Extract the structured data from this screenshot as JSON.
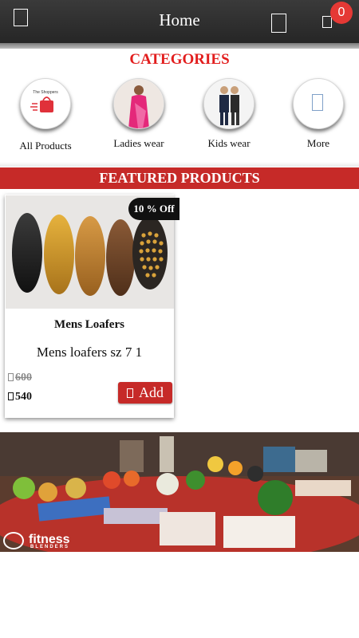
{
  "header": {
    "title": "Home",
    "cart_count": "0",
    "menu_icon": "menu-icon",
    "search_icon": "search-icon",
    "cart_icon": "cart-icon"
  },
  "categories": {
    "title": "CATEGORIES",
    "items": [
      {
        "label": "All Products",
        "logo_text": "The Shoppers"
      },
      {
        "label": "Ladies wear"
      },
      {
        "label": "Kids wear"
      },
      {
        "label": "More",
        "icon": "more-icon"
      }
    ]
  },
  "featured": {
    "title": "FEATURED PRODUCTS",
    "products": [
      {
        "name": "Mens Loafers",
        "description": "Mens loafers sz 7 1",
        "discount": "10 % Off",
        "old_price": "600",
        "new_price": "540",
        "add_label": "Add"
      }
    ]
  },
  "promo": {
    "brand": "fitness",
    "brand_sub": "BLENDERS"
  },
  "colors": {
    "appbar": "#2f2f2f",
    "accent_red": "#c62a28",
    "category_title": "#e21d1d",
    "badge": "#e53935"
  }
}
